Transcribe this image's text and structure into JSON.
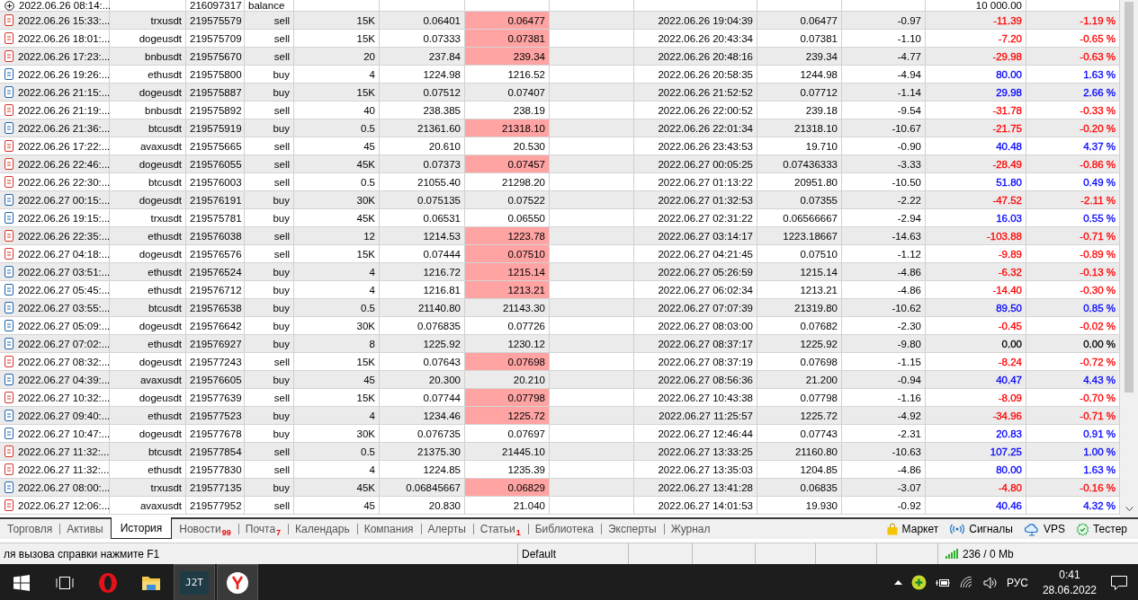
{
  "history_table": {
    "balance_row": {
      "open_time": "2022.06.26 08:14:...",
      "ticket": "216097317",
      "type": "balance",
      "profit": "10 000.00"
    },
    "rows": [
      {
        "open_time": "2022.06.26 15:33:...",
        "symbol": "trxusdt",
        "ticket": "219575579",
        "type": "sell",
        "kind": "sell",
        "volume": "15K",
        "price": "0.06401",
        "sl": "0.06477",
        "sl_highlighted": true,
        "close_time": "2022.06.26 19:04:39",
        "close_price": "0.06477",
        "commission": "-0.97",
        "profit": "-11.39",
        "change": "-1.19 %",
        "color": "#ff0000"
      },
      {
        "open_time": "2022.06.26 18:01:...",
        "symbol": "dogeusdt",
        "ticket": "219575709",
        "type": "sell",
        "kind": "sell",
        "volume": "15K",
        "price": "0.07333",
        "sl": "0.07381",
        "sl_highlighted": true,
        "close_time": "2022.06.26 20:43:34",
        "close_price": "0.07381",
        "commission": "-1.10",
        "profit": "-7.20",
        "change": "-0.65 %",
        "color": "#ff0000"
      },
      {
        "open_time": "2022.06.26 17:23:...",
        "symbol": "bnbusdt",
        "ticket": "219575670",
        "type": "sell",
        "kind": "sell",
        "volume": "20",
        "price": "237.84",
        "sl": "239.34",
        "sl_highlighted": true,
        "close_time": "2022.06.26 20:48:16",
        "close_price": "239.34",
        "commission": "-4.77",
        "profit": "-29.98",
        "change": "-0.63 %",
        "color": "#ff0000"
      },
      {
        "open_time": "2022.06.26 19:26:...",
        "symbol": "ethusdt",
        "ticket": "219575800",
        "type": "buy",
        "kind": "buy",
        "volume": "4",
        "price": "1224.98",
        "sl": "1216.52",
        "sl_highlighted": false,
        "close_time": "2022.06.26 20:58:35",
        "close_price": "1244.98",
        "commission": "-4.94",
        "profit": "80.00",
        "change": "1.63 %",
        "color": "#0000ff"
      },
      {
        "open_time": "2022.06.26 21:15:...",
        "symbol": "dogeusdt",
        "ticket": "219575887",
        "type": "buy",
        "kind": "buy",
        "volume": "15K",
        "price": "0.07512",
        "sl": "0.07407",
        "sl_highlighted": false,
        "close_time": "2022.06.26 21:52:52",
        "close_price": "0.07712",
        "commission": "-1.14",
        "profit": "29.98",
        "change": "2.66 %",
        "color": "#0000ff"
      },
      {
        "open_time": "2022.06.26 21:19:...",
        "symbol": "bnbusdt",
        "ticket": "219575892",
        "type": "sell",
        "kind": "sell",
        "volume": "40",
        "price": "238.385",
        "sl": "238.19",
        "sl_highlighted": false,
        "close_time": "2022.06.26 22:00:52",
        "close_price": "239.18",
        "commission": "-9.54",
        "profit": "-31.78",
        "change": "-0.33 %",
        "color": "#ff0000"
      },
      {
        "open_time": "2022.06.26 21:36:...",
        "symbol": "btcusdt",
        "ticket": "219575919",
        "type": "buy",
        "kind": "buy",
        "volume": "0.5",
        "price": "21361.60",
        "sl": "21318.10",
        "sl_highlighted": true,
        "close_time": "2022.06.26 22:01:34",
        "close_price": "21318.10",
        "commission": "-10.67",
        "profit": "-21.75",
        "change": "-0.20 %",
        "color": "#ff0000"
      },
      {
        "open_time": "2022.06.26 17:22:...",
        "symbol": "avaxusdt",
        "ticket": "219575665",
        "type": "sell",
        "kind": "sell",
        "volume": "45",
        "price": "20.610",
        "sl": "20.530",
        "sl_highlighted": false,
        "close_time": "2022.06.26 23:43:53",
        "close_price": "19.710",
        "commission": "-0.90",
        "profit": "40.48",
        "change": "4.37 %",
        "color": "#0000ff"
      },
      {
        "open_time": "2022.06.26 22:46:...",
        "symbol": "dogeusdt",
        "ticket": "219576055",
        "type": "sell",
        "kind": "sell",
        "volume": "45K",
        "price": "0.07373",
        "sl": "0.07457",
        "sl_highlighted": true,
        "close_time": "2022.06.27 00:05:25",
        "close_price": "0.07436333",
        "commission": "-3.33",
        "profit": "-28.49",
        "change": "-0.86 %",
        "color": "#ff0000"
      },
      {
        "open_time": "2022.06.26 22:30:...",
        "symbol": "btcusdt",
        "ticket": "219576003",
        "type": "sell",
        "kind": "sell",
        "volume": "0.5",
        "price": "21055.40",
        "sl": "21298.20",
        "sl_highlighted": false,
        "close_time": "2022.06.27 01:13:22",
        "close_price": "20951.80",
        "commission": "-10.50",
        "profit": "51.80",
        "change": "0.49 %",
        "color": "#0000ff"
      },
      {
        "open_time": "2022.06.27 00:15:...",
        "symbol": "dogeusdt",
        "ticket": "219576191",
        "type": "buy",
        "kind": "buy",
        "volume": "30K",
        "price": "0.075135",
        "sl": "0.07522",
        "sl_highlighted": false,
        "close_time": "2022.06.27 01:32:53",
        "close_price": "0.07355",
        "commission": "-2.22",
        "profit": "-47.52",
        "change": "-2.11 %",
        "color": "#ff0000"
      },
      {
        "open_time": "2022.06.26 19:15:...",
        "symbol": "trxusdt",
        "ticket": "219575781",
        "type": "buy",
        "kind": "buy",
        "volume": "45K",
        "price": "0.06531",
        "sl": "0.06550",
        "sl_highlighted": false,
        "close_time": "2022.06.27 02:31:22",
        "close_price": "0.06566667",
        "commission": "-2.94",
        "profit": "16.03",
        "change": "0.55 %",
        "color": "#0000ff"
      },
      {
        "open_time": "2022.06.26 22:35:...",
        "symbol": "ethusdt",
        "ticket": "219576038",
        "type": "sell",
        "kind": "sell",
        "volume": "12",
        "price": "1214.53",
        "sl": "1223.78",
        "sl_highlighted": true,
        "close_time": "2022.06.27 03:14:17",
        "close_price": "1223.18667",
        "commission": "-14.63",
        "profit": "-103.88",
        "change": "-0.71 %",
        "color": "#ff0000"
      },
      {
        "open_time": "2022.06.27 04:18:...",
        "symbol": "dogeusdt",
        "ticket": "219576576",
        "type": "sell",
        "kind": "sell",
        "volume": "15K",
        "price": "0.07444",
        "sl": "0.07510",
        "sl_highlighted": true,
        "close_time": "2022.06.27 04:21:45",
        "close_price": "0.07510",
        "commission": "-1.12",
        "profit": "-9.89",
        "change": "-0.89 %",
        "color": "#ff0000"
      },
      {
        "open_time": "2022.06.27 03:51:...",
        "symbol": "ethusdt",
        "ticket": "219576524",
        "type": "buy",
        "kind": "buy",
        "volume": "4",
        "price": "1216.72",
        "sl": "1215.14",
        "sl_highlighted": true,
        "close_time": "2022.06.27 05:26:59",
        "close_price": "1215.14",
        "commission": "-4.86",
        "profit": "-6.32",
        "change": "-0.13 %",
        "color": "#ff0000"
      },
      {
        "open_time": "2022.06.27 05:45:...",
        "symbol": "ethusdt",
        "ticket": "219576712",
        "type": "buy",
        "kind": "buy",
        "volume": "4",
        "price": "1216.81",
        "sl": "1213.21",
        "sl_highlighted": true,
        "close_time": "2022.06.27 06:02:34",
        "close_price": "1213.21",
        "commission": "-4.86",
        "profit": "-14.40",
        "change": "-0.30 %",
        "color": "#ff0000"
      },
      {
        "open_time": "2022.06.27 03:55:...",
        "symbol": "btcusdt",
        "ticket": "219576538",
        "type": "buy",
        "kind": "buy",
        "volume": "0.5",
        "price": "21140.80",
        "sl": "21143.30",
        "sl_highlighted": false,
        "close_time": "2022.06.27 07:07:39",
        "close_price": "21319.80",
        "commission": "-10.62",
        "profit": "89.50",
        "change": "0.85 %",
        "color": "#0000ff"
      },
      {
        "open_time": "2022.06.27 05:09:...",
        "symbol": "dogeusdt",
        "ticket": "219576642",
        "type": "buy",
        "kind": "buy",
        "volume": "30K",
        "price": "0.076835",
        "sl": "0.07726",
        "sl_highlighted": false,
        "close_time": "2022.06.27 08:03:00",
        "close_price": "0.07682",
        "commission": "-2.30",
        "profit": "-0.45",
        "change": "-0.02 %",
        "color": "#ff0000"
      },
      {
        "open_time": "2022.06.27 07:02:...",
        "symbol": "ethusdt",
        "ticket": "219576927",
        "type": "buy",
        "kind": "buy",
        "volume": "8",
        "price": "1225.92",
        "sl": "1230.12",
        "sl_highlighted": false,
        "close_time": "2022.06.27 08:37:17",
        "close_price": "1225.92",
        "commission": "-9.80",
        "profit": "0.00",
        "change": "0.00 %",
        "color": "#000000"
      },
      {
        "open_time": "2022.06.27 08:32:...",
        "symbol": "dogeusdt",
        "ticket": "219577243",
        "type": "sell",
        "kind": "sell",
        "volume": "15K",
        "price": "0.07643",
        "sl": "0.07698",
        "sl_highlighted": true,
        "close_time": "2022.06.27 08:37:19",
        "close_price": "0.07698",
        "commission": "-1.15",
        "profit": "-8.24",
        "change": "-0.72 %",
        "color": "#ff0000"
      },
      {
        "open_time": "2022.06.27 04:39:...",
        "symbol": "avaxusdt",
        "ticket": "219576605",
        "type": "buy",
        "kind": "buy",
        "volume": "45",
        "price": "20.300",
        "sl": "20.210",
        "sl_highlighted": false,
        "close_time": "2022.06.27 08:56:36",
        "close_price": "21.200",
        "commission": "-0.94",
        "profit": "40.47",
        "change": "4.43 %",
        "color": "#0000ff"
      },
      {
        "open_time": "2022.06.27 10:32:...",
        "symbol": "dogeusdt",
        "ticket": "219577639",
        "type": "sell",
        "kind": "sell",
        "volume": "15K",
        "price": "0.07744",
        "sl": "0.07798",
        "sl_highlighted": true,
        "close_time": "2022.06.27 10:43:38",
        "close_price": "0.07798",
        "commission": "-1.16",
        "profit": "-8.09",
        "change": "-0.70 %",
        "color": "#ff0000"
      },
      {
        "open_time": "2022.06.27 09:40:...",
        "symbol": "ethusdt",
        "ticket": "219577523",
        "type": "buy",
        "kind": "buy",
        "volume": "4",
        "price": "1234.46",
        "sl": "1225.72",
        "sl_highlighted": true,
        "close_time": "2022.06.27 11:25:57",
        "close_price": "1225.72",
        "commission": "-4.92",
        "profit": "-34.96",
        "change": "-0.71 %",
        "color": "#ff0000"
      },
      {
        "open_time": "2022.06.27 10:47:...",
        "symbol": "dogeusdt",
        "ticket": "219577678",
        "type": "buy",
        "kind": "buy",
        "volume": "30K",
        "price": "0.076735",
        "sl": "0.07697",
        "sl_highlighted": false,
        "close_time": "2022.06.27 12:46:44",
        "close_price": "0.07743",
        "commission": "-2.31",
        "profit": "20.83",
        "change": "0.91 %",
        "color": "#0000ff"
      },
      {
        "open_time": "2022.06.27 11:32:...",
        "symbol": "btcusdt",
        "ticket": "219577854",
        "type": "sell",
        "kind": "sell",
        "volume": "0.5",
        "price": "21375.30",
        "sl": "21445.10",
        "sl_highlighted": false,
        "close_time": "2022.06.27 13:33:25",
        "close_price": "21160.80",
        "commission": "-10.63",
        "profit": "107.25",
        "change": "1.00 %",
        "color": "#0000ff"
      },
      {
        "open_time": "2022.06.27 11:32:...",
        "symbol": "ethusdt",
        "ticket": "219577830",
        "type": "sell",
        "kind": "sell",
        "volume": "4",
        "price": "1224.85",
        "sl": "1235.39",
        "sl_highlighted": false,
        "close_time": "2022.06.27 13:35:03",
        "close_price": "1204.85",
        "commission": "-4.86",
        "profit": "80.00",
        "change": "1.63 %",
        "color": "#0000ff"
      },
      {
        "open_time": "2022.06.27 08:00:...",
        "symbol": "trxusdt",
        "ticket": "219577135",
        "type": "buy",
        "kind": "buy",
        "volume": "45K",
        "price": "0.06845667",
        "sl": "0.06829",
        "sl_highlighted": true,
        "close_time": "2022.06.27 13:41:28",
        "close_price": "0.06835",
        "commission": "-3.07",
        "profit": "-4.80",
        "change": "-0.16 %",
        "color": "#ff0000"
      },
      {
        "open_time": "2022.06.27 12:06:...",
        "symbol": "avaxusdt",
        "ticket": "219577952",
        "type": "sell",
        "kind": "sell",
        "volume": "45",
        "price": "20.830",
        "sl": "21.040",
        "sl_highlighted": false,
        "close_time": "2022.06.27 14:01:53",
        "close_price": "19.930",
        "commission": "-0.92",
        "profit": "40.46",
        "change": "4.32 %",
        "color": "#0000ff"
      }
    ]
  },
  "bottom_tabs": [
    {
      "label": "Торговля",
      "selected": false
    },
    {
      "label": "Активы",
      "selected": false
    },
    {
      "label": "История",
      "selected": true
    },
    {
      "label": "Новости",
      "badge": "99",
      "selected": false
    },
    {
      "label": "Почта",
      "badge": "7",
      "selected": false
    },
    {
      "label": "Календарь",
      "selected": false
    },
    {
      "label": "Компания",
      "selected": false
    },
    {
      "label": "Алерты",
      "selected": false
    },
    {
      "label": "Статьи",
      "badge": "1",
      "selected": false
    },
    {
      "label": "Библиотека",
      "selected": false
    },
    {
      "label": "Эксперты",
      "selected": false
    },
    {
      "label": "Журнал",
      "selected": false
    }
  ],
  "toolbar_links": [
    {
      "label": "Маркет",
      "kind": "market"
    },
    {
      "label": "Сигналы",
      "kind": "signals"
    },
    {
      "label": "VPS",
      "kind": "vps"
    },
    {
      "label": "Тестер",
      "kind": "tester"
    }
  ],
  "status_bar": {
    "help": "ля вызова справки нажмите F1",
    "profile": "Default",
    "traffic": "236 / 0 Mb"
  },
  "taskbar": {
    "apps": [
      {
        "kind": "opera"
      },
      {
        "kind": "explorer"
      },
      {
        "kind": "j2t",
        "label": "J2T",
        "selected": true
      },
      {
        "kind": "yandex",
        "selected": true
      }
    ],
    "language": "РУС",
    "time": "0:41",
    "date": "28.06.2022"
  }
}
